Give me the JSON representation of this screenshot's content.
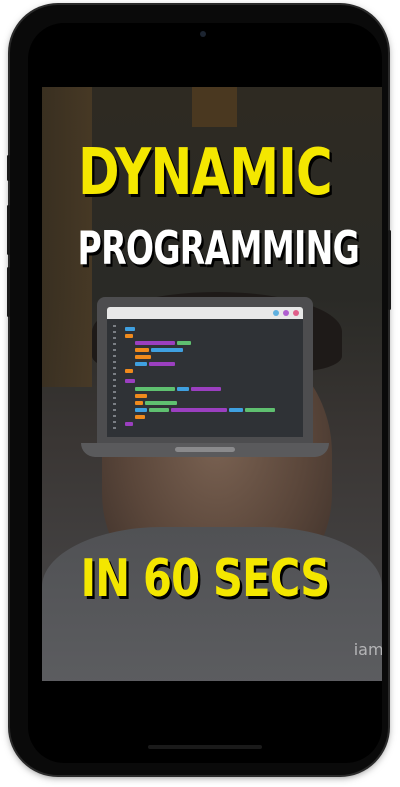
{
  "thumbnail": {
    "title_line1": "DYNAMIC",
    "title_line2": "PROGRAMMING",
    "subtitle": "IN 60 SECS",
    "watermark": "iaml"
  },
  "colors": {
    "title_yellow": "#f4e700",
    "title_white": "#ffffff",
    "phone_frame": "#0a0a0a",
    "code_background": "#2f3236"
  },
  "icons": {
    "laptop": "laptop-code-icon"
  }
}
